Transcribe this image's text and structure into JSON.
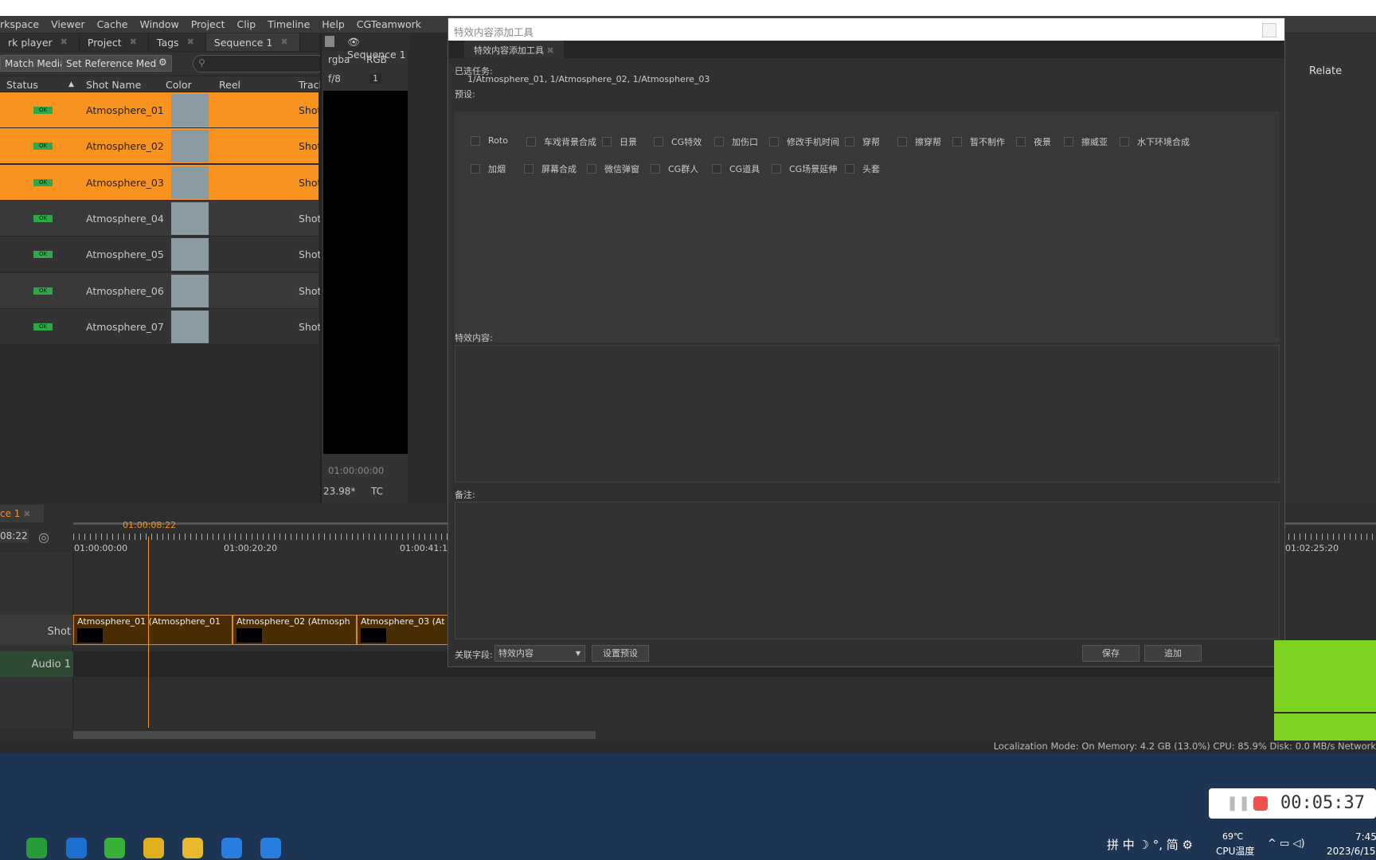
{
  "menu": [
    "rkspace",
    "Viewer",
    "Cache",
    "Window",
    "Project",
    "Clip",
    "Timeline",
    "Help",
    "CGTeamwork"
  ],
  "tabs": [
    "rk player",
    "Project",
    "Tags",
    "Sequence 1"
  ],
  "toolbar": {
    "match_media": "Match Media",
    "set_reference": "Set Reference Media"
  },
  "columns": [
    "Status",
    "Shot Name",
    "Color",
    "Reel",
    "Track"
  ],
  "rows": [
    {
      "status": "OK",
      "name": "Atmosphere_01",
      "track": "Shot",
      "selected": true
    },
    {
      "status": "OK",
      "name": "Atmosphere_02",
      "track": "Shot",
      "selected": true
    },
    {
      "status": "OK",
      "name": "Atmosphere_03",
      "track": "Shot",
      "selected": true
    },
    {
      "status": "OK",
      "name": "Atmosphere_04",
      "track": "Shot",
      "selected": false
    },
    {
      "status": "OK",
      "name": "Atmosphere_05",
      "track": "Shot",
      "selected": false
    },
    {
      "status": "OK",
      "name": "Atmosphere_06",
      "track": "Shot",
      "selected": false
    },
    {
      "status": "OK",
      "name": "Atmosphere_07",
      "track": "Shot",
      "selected": false
    }
  ],
  "viewer": {
    "tab": "Sequence 1",
    "channel": "rgba",
    "colorspace": "RGB",
    "fstop": "f/8",
    "frame": "1",
    "timecode": "01:00:00:00",
    "fps": "23.98*",
    "tc_mode": "TC"
  },
  "right_panel": {
    "label": "Relate"
  },
  "dialog": {
    "title": "特效内容添加工具",
    "tab": "特效内容添加工具",
    "selected_label": "已选任务:",
    "selected_value": "1/Atmosphere_01, 1/Atmosphere_02, 1/Atmosphere_03",
    "presets_label": "预设:",
    "presets_row1": [
      "Roto",
      "车戏背景合成",
      "日景",
      "CG特效",
      "加伤口",
      "修改手机时间",
      "穿帮",
      "擦穿帮",
      "暂不制作",
      "夜景",
      "擦威亚",
      "水下环境合成"
    ],
    "presets_row2": [
      "加烟",
      "屏幕合成",
      "微信弹窗",
      "CG群人",
      "CG道具",
      "CG场景延伸",
      "头套"
    ],
    "content_label": "特效内容:",
    "notes_label": "备注:",
    "field_label": "关联字段:",
    "field_value": "特效内容",
    "set_preset": "设置预设",
    "save": "保存",
    "append": "追加"
  },
  "timeline": {
    "tab": "ce 1",
    "current": "08:22",
    "playhead": "01:00:08:22",
    "ticks": [
      "01:00:00:00",
      "01:00:20:20",
      "01:00:41:1",
      "01:02:25:20"
    ],
    "track_shot": "Shot",
    "track_audio": "Audio 1",
    "clips": [
      "Atmosphere_01 (Atmosphere_01",
      "Atmosphere_02 (Atmosph",
      "Atmosphere_03 (At"
    ]
  },
  "status_bar": "Localization Mode: On  Memory: 4.2 GB (13.0%)  CPU: 85.9%  Disk: 0.0 MB/s  Network",
  "recorder": {
    "time": "00:05:37"
  },
  "tray": {
    "ime": "拼 中 ☽ °, 简 ⚙",
    "temp": "69℃",
    "temp_label": "CPU温度",
    "time": "7:45",
    "date": "2023/6/15"
  },
  "colors": {
    "selection": "#f7931e",
    "ok": "#2fa84a",
    "taskbar": "#1d3553"
  }
}
